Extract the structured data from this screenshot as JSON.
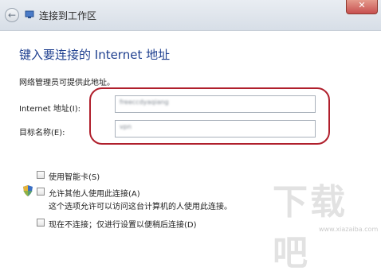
{
  "window": {
    "title": "连接到工作区",
    "close_label": "✕"
  },
  "heading": "键入要连接的 Internet 地址",
  "info_text": "网络管理员可提供此地址。",
  "fields": {
    "internet_address_label": "Internet 地址(I):",
    "internet_address_value": "freeccdyaqiang",
    "destination_name_label": "目标名称(E):",
    "destination_name_value": "vpn"
  },
  "options": {
    "smart_card": "使用智能卡(S)",
    "allow_others": "允许其他人使用此连接(A)",
    "allow_others_hint": "这个选项允许可以访问这台计算机的人使用此连接。",
    "dont_connect": "现在不连接；仅进行设置以便稍后连接(D)"
  },
  "watermark": {
    "text": "下载吧",
    "url": "www.xiazaiba.com"
  },
  "colors": {
    "heading": "#1e3f8f",
    "highlight_ring": "#b01f2c"
  }
}
